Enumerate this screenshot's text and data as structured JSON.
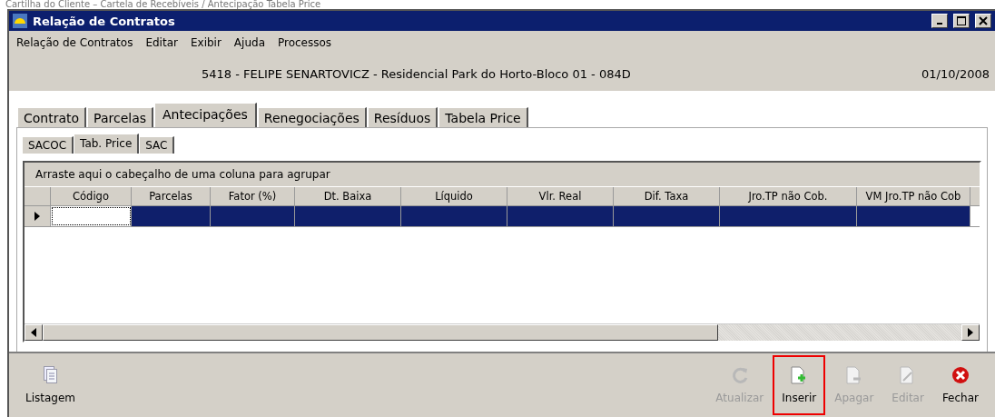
{
  "caption": "Cartilha do Cliente – Cartela de Recebíveis / Antecipação Tabela Price",
  "window": {
    "title": "Relação de Contratos"
  },
  "menu": [
    "Relação de Contratos",
    "Editar",
    "Exibir",
    "Ajuda",
    "Processos"
  ],
  "header": {
    "contract": "5418 - FELIPE SENARTOVICZ - Residencial Park do Horto-Bloco 01 - 084D",
    "date": "01/10/2008"
  },
  "tabs": [
    {
      "label": "Contrato",
      "selected": false
    },
    {
      "label": "Parcelas",
      "selected": false
    },
    {
      "label": "Antecipações",
      "selected": true
    },
    {
      "label": "Renegociações",
      "selected": false
    },
    {
      "label": "Resíduos",
      "selected": false
    },
    {
      "label": "Tabela Price",
      "selected": false
    }
  ],
  "subtabs": [
    {
      "label": "SACOC",
      "selected": false
    },
    {
      "label": "Tab. Price",
      "selected": true
    },
    {
      "label": "SAC",
      "selected": false
    }
  ],
  "grid": {
    "group_hint": "Arraste aqui o cabeçalho de uma coluna para agrupar",
    "columns": [
      "Código",
      "Parcelas",
      "Fator (%)",
      "Dt. Baixa",
      "Líquido",
      "Vlr. Real",
      "Dif. Taxa",
      "Jro.TP não Cob.",
      "VM Jro.TP não Cob"
    ],
    "rows": [
      {
        "selected": true
      }
    ]
  },
  "toolbar": [
    {
      "kind": "list",
      "label": "Listagem",
      "disabled": false,
      "highlighted": false
    },
    {
      "kind": "refresh",
      "label": "Atualizar",
      "disabled": true,
      "highlighted": false
    },
    {
      "kind": "insert",
      "label": "Inserir",
      "disabled": false,
      "highlighted": true
    },
    {
      "kind": "delete",
      "label": "Apagar",
      "disabled": true,
      "highlighted": false
    },
    {
      "kind": "edit",
      "label": "Editar",
      "disabled": true,
      "highlighted": false
    },
    {
      "kind": "close",
      "label": "Fechar",
      "disabled": false,
      "highlighted": false
    }
  ]
}
